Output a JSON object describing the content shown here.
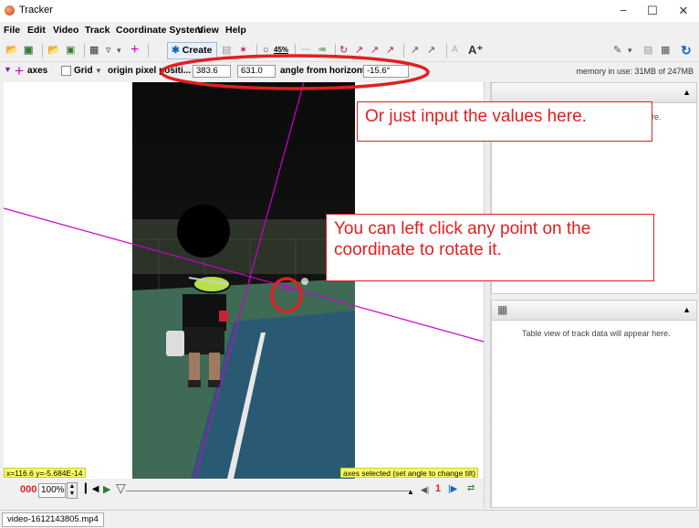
{
  "window": {
    "title": "Tracker",
    "icon": "tracker-app-icon",
    "minimize": "−",
    "maximize": "☐",
    "close": "✕"
  },
  "menu": [
    "File",
    "Edit",
    "Video",
    "Track",
    "Coordinate System",
    "View",
    "Help"
  ],
  "toolbar": {
    "create_label": "Create",
    "zoom_label": "45%"
  },
  "axes_bar": {
    "axes_label": "axes",
    "grid_label": "Grid",
    "grid_checked": false,
    "origin_label": "origin pixel positi...",
    "origin_x": "383.6",
    "origin_y": "631.0",
    "angle_label": "angle from horizontal",
    "angle_value": "-15.6°",
    "memory": "memory in use: 31MB of 247MB"
  },
  "video": {
    "readout": "x=116.6  y=-5.684E-14",
    "status": "axes selected (set angle to change tilt)"
  },
  "player": {
    "frame": "000",
    "rate": "100%",
    "step": "1"
  },
  "right_panel": {
    "plot_hint": "Plot view of track data will appear here.",
    "plot_hint_visible": "ere.",
    "table_hint": "Table view of track data will appear here."
  },
  "callouts": {
    "top": "Or just input the values here.",
    "middle": "You can left click any point on the coordinate to rotate it."
  },
  "file_tab": "video-1612143805.mp4",
  "colors": {
    "axis": "#cc00cc",
    "annotation": "#e02020",
    "court_blue": "#2a5a73",
    "court_green": "#3f6a55"
  }
}
